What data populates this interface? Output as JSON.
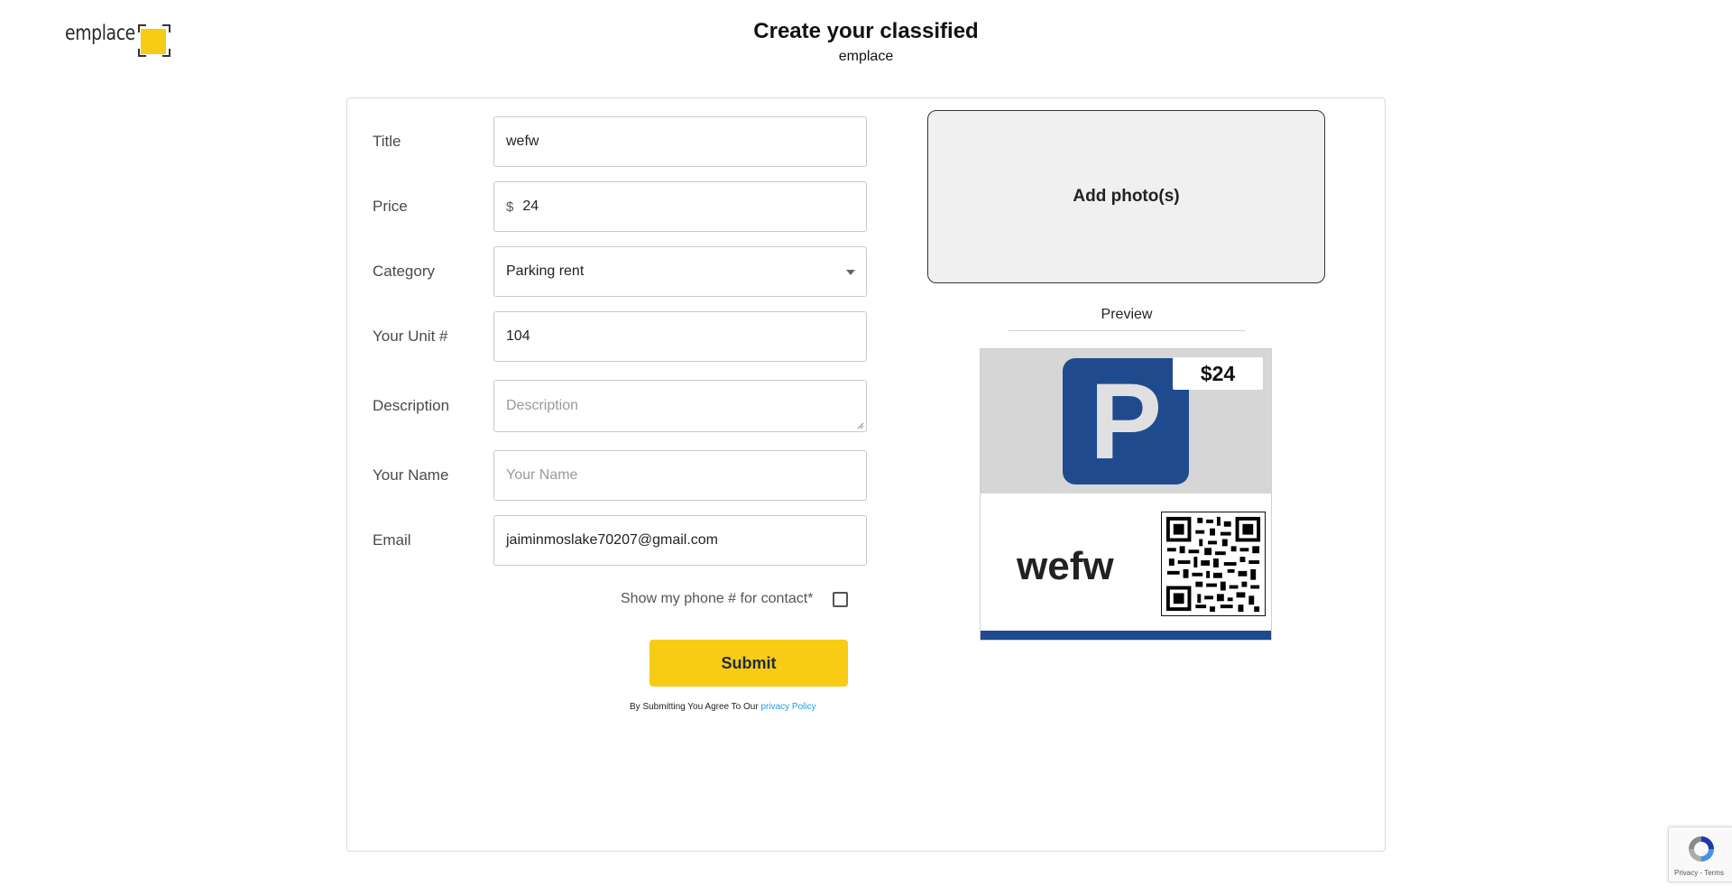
{
  "brand": {
    "logo_text": "emplace",
    "accent_color": "#f8cb14"
  },
  "header": {
    "title": "Create your classified",
    "subtitle": "emplace"
  },
  "form": {
    "title": {
      "label": "Title",
      "value": "wefw"
    },
    "price": {
      "label": "Price",
      "currency": "$",
      "value": "24"
    },
    "category": {
      "label": "Category",
      "value": "Parking rent"
    },
    "unit": {
      "label": "Your Unit #",
      "value": "104"
    },
    "description": {
      "label": "Description",
      "placeholder": "Description",
      "value": ""
    },
    "name": {
      "label": "Your Name",
      "placeholder": "Your Name",
      "value": ""
    },
    "email": {
      "label": "Email",
      "value": "jaiminmoslake70207@gmail.com"
    },
    "show_phone": {
      "label": "Show my phone # for contact",
      "required_mark": "*",
      "checked": false
    },
    "submit_label": "Submit",
    "terms_text": "By Submitting You Agree To Our",
    "terms_link": "privacy Policy"
  },
  "photo": {
    "label": "Add photo(s)"
  },
  "preview": {
    "heading": "Preview",
    "price_badge": "$24",
    "title": "wefw",
    "sign_letter": "P",
    "sign_color": "#1f4b8e"
  },
  "recaptcha": {
    "links": "Privacy - Terms"
  }
}
